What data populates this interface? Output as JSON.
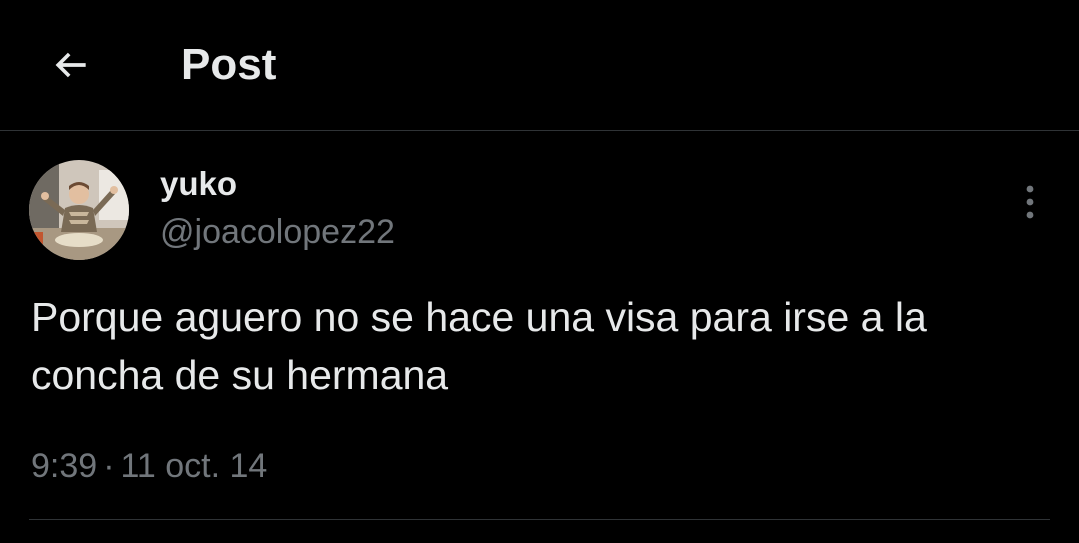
{
  "header": {
    "back_icon": "arrow-left-icon",
    "title": "Post"
  },
  "post": {
    "author": {
      "display_name": "yuko",
      "handle": "@joacolopez22",
      "avatar": "avatar-photo"
    },
    "more_icon": "more-vertical-icon",
    "text": "Porque aguero no se hace una visa para irse a la concha de su hermana",
    "time": "9:39",
    "separator": "·",
    "date": "11 oct. 14"
  },
  "colors": {
    "background": "#000000",
    "primary_text": "#e7e9ea",
    "secondary_text": "#71767b",
    "border": "#2f3336"
  }
}
